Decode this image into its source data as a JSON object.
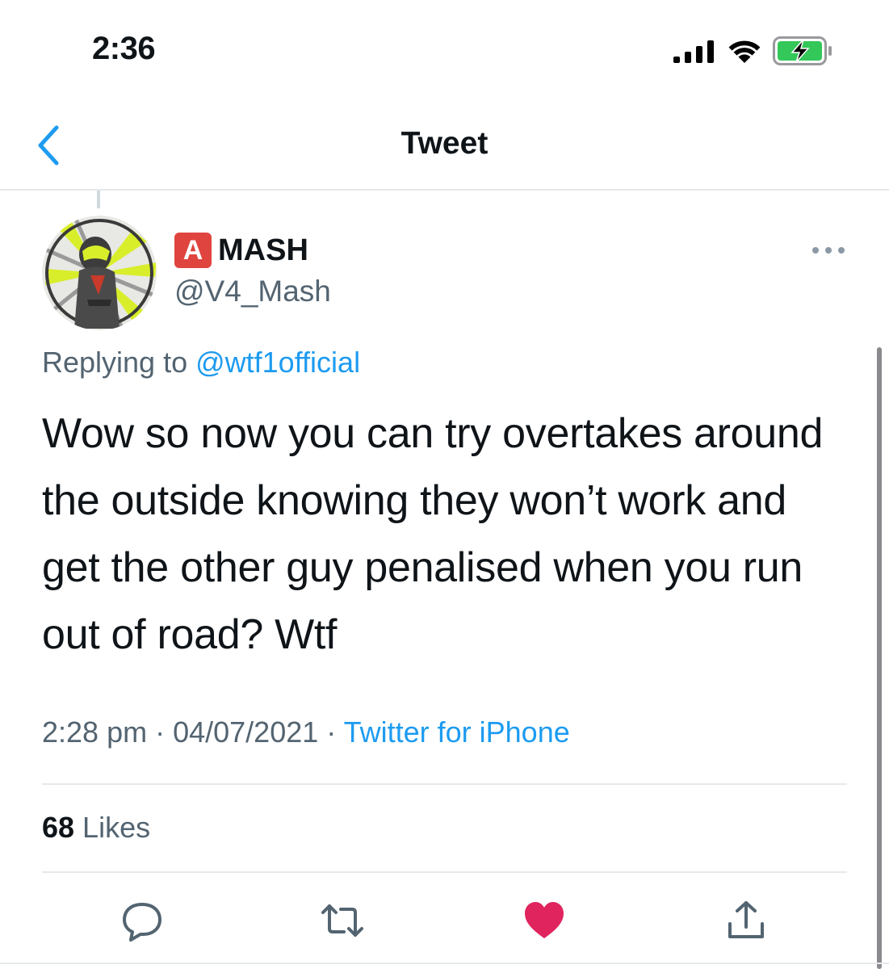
{
  "status_bar": {
    "time": "2:36"
  },
  "nav": {
    "title": "Tweet"
  },
  "tweet": {
    "author": {
      "badge": "A",
      "name": "MASH",
      "handle": "@V4_Mash"
    },
    "replying_to": {
      "prefix": "Replying to ",
      "mention": "@wtf1official"
    },
    "text": "Wow so now you can try overtakes around the outside knowing they won’t work and get the other guy penalised when you run out of road? Wtf",
    "time": "2:28 pm",
    "sep1": " · ",
    "date": "04/07/2021",
    "sep2": " · ",
    "source": "Twitter for iPhone",
    "likes_count": "68",
    "likes_label": " Likes"
  },
  "actions": [
    {
      "icon": "reply-icon"
    },
    {
      "icon": "retweet-icon"
    },
    {
      "icon": "like-icon",
      "active": true,
      "color": "#e0245e"
    },
    {
      "icon": "share-icon"
    }
  ],
  "colors": {
    "accent": "#1d9bf0",
    "secondary_text": "#536471",
    "like_active": "#e0245e",
    "battery_fill": "#34c759",
    "badge": "#e0443e"
  }
}
